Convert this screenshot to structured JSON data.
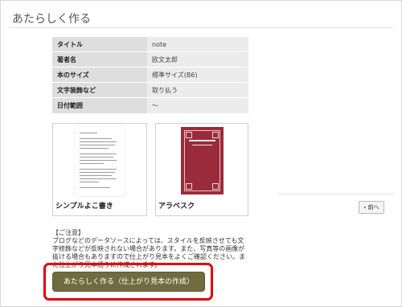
{
  "page": {
    "title": "あたらしく作る"
  },
  "info": [
    {
      "key": "タイトル",
      "value": "note"
    },
    {
      "key": "著者名",
      "value": "欧文太郎"
    },
    {
      "key": "本のサイズ",
      "value": "標準サイズ(B6)"
    },
    {
      "key": "文字装飾など",
      "value": "取り払う"
    },
    {
      "key": "日付範囲",
      "value": "〜"
    }
  ],
  "templates": [
    {
      "label": "シンプルよこ書き"
    },
    {
      "label": "アラベスク"
    }
  ],
  "nav": {
    "prev_label": "前へ",
    "prev_icon": "chevron-left-icon"
  },
  "notice": {
    "heading": "【ご注意】",
    "body": "ブログなどのデータソースによっては、スタイルを反映させても文字修飾などが反映されない場合があります。また、写真等の画像が抜ける場合もありますので仕上がり見本をよくご確認ください。また仕上がり見本通りに作成されます。"
  },
  "action": {
    "create_label": "あたらしく作る（仕上がり見本の作成）"
  },
  "colors": {
    "button": "#706c3f",
    "highlight": "#e30000",
    "cover": "#9b2a3b"
  }
}
